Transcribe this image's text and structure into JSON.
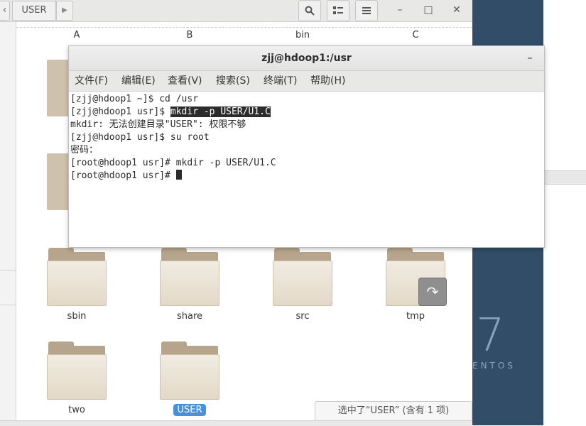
{
  "file_manager": {
    "breadcrumb": {
      "current": "USER"
    },
    "column_labels": [
      "A",
      "B",
      "bin",
      "C"
    ],
    "folders": [
      {
        "name": "sbin"
      },
      {
        "name": "share"
      },
      {
        "name": "src"
      },
      {
        "name": "tmp"
      },
      {
        "name": "two"
      },
      {
        "name": "USER",
        "selected": true
      }
    ],
    "status": "选中了“USER” (含有 1 项)"
  },
  "terminal": {
    "title": "zjj@hdoop1:/usr",
    "menu": [
      "文件(F)",
      "编辑(E)",
      "查看(V)",
      "搜索(S)",
      "终端(T)",
      "帮助(H)"
    ],
    "lines": [
      {
        "prompt": "[zjj@hdoop1 ~]$ ",
        "cmd": "cd /usr"
      },
      {
        "prompt": "[zjj@hdoop1 usr]$ ",
        "cmd": "mkdir -p USER/U1.C"
      },
      {
        "prompt": "",
        "cmd": "mkdir: 无法创建目录\"USER\": 权限不够"
      },
      {
        "prompt": "[zjj@hdoop1 usr]$ ",
        "cmd": "su root"
      },
      {
        "prompt": "",
        "cmd": "密码："
      },
      {
        "prompt": "[root@hdoop1 usr]# ",
        "cmd": "mkdir -p USER/U1.C"
      },
      {
        "prompt": "[root@hdoop1 usr]# ",
        "cmd": ""
      }
    ]
  },
  "desktop": {
    "brand_number": "7",
    "brand_text": "ENTOS"
  }
}
